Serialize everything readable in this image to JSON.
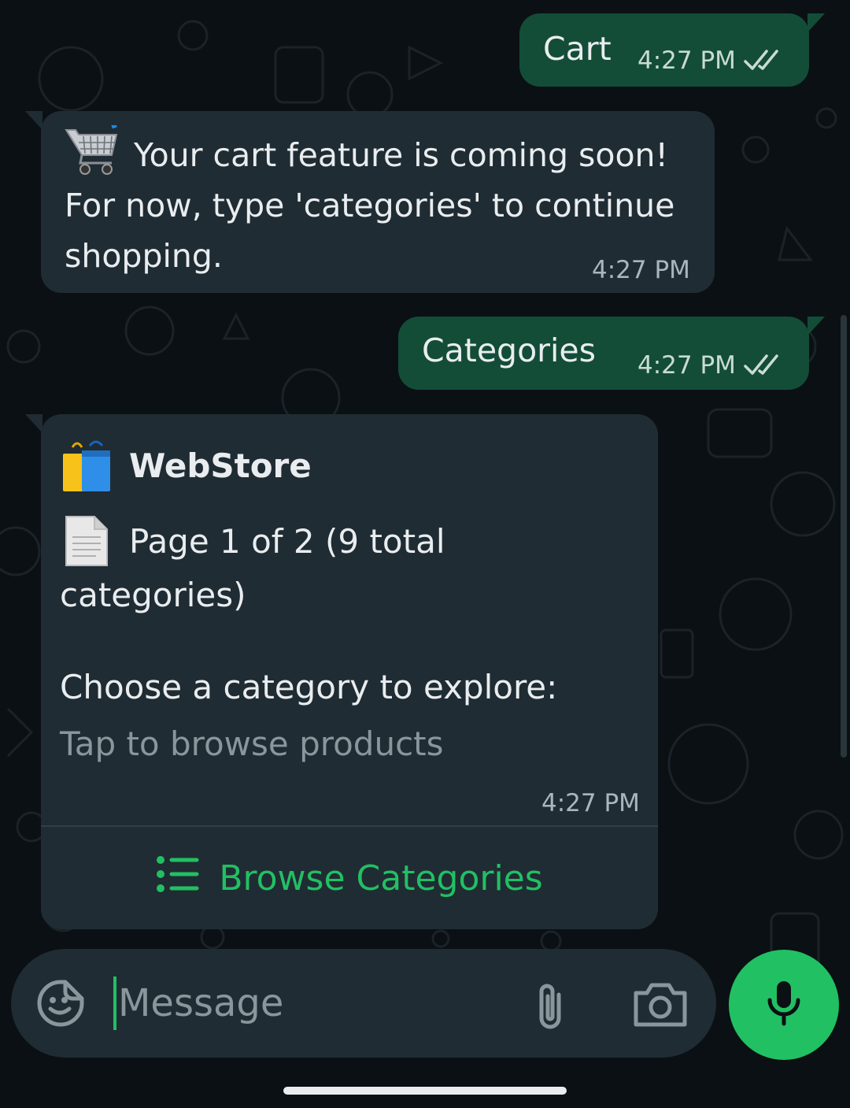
{
  "messages": [
    {
      "id": "m1",
      "direction": "outgoing",
      "text": "Cart",
      "time": "4:27 PM",
      "status": "read"
    },
    {
      "id": "m2",
      "direction": "incoming",
      "emoji": "shopping-cart-icon",
      "text": "Your cart feature is coming soon! For now, type 'categories' to continue shopping.",
      "time": "4:27 PM"
    },
    {
      "id": "m3",
      "direction": "outgoing",
      "text": "Categories",
      "time": "4:27 PM",
      "status": "read"
    },
    {
      "id": "m4",
      "direction": "incoming",
      "header_emoji": "shopping-bags-icon",
      "header": "WebStore",
      "page_emoji": "page-icon",
      "page_info": "Page 1 of 2 (9 total categories)",
      "body": "Choose a category to explore:",
      "footer": "Tap to browse products",
      "time": "4:27 PM",
      "button_label": "Browse Categories"
    }
  ],
  "composer": {
    "placeholder": "Message"
  },
  "colors": {
    "outgoing_bubble": "#134d37",
    "incoming_bubble": "#202c33",
    "accent_green": "#21c063",
    "background": "#0b1014",
    "read_ticks": "#c9dcd3"
  }
}
